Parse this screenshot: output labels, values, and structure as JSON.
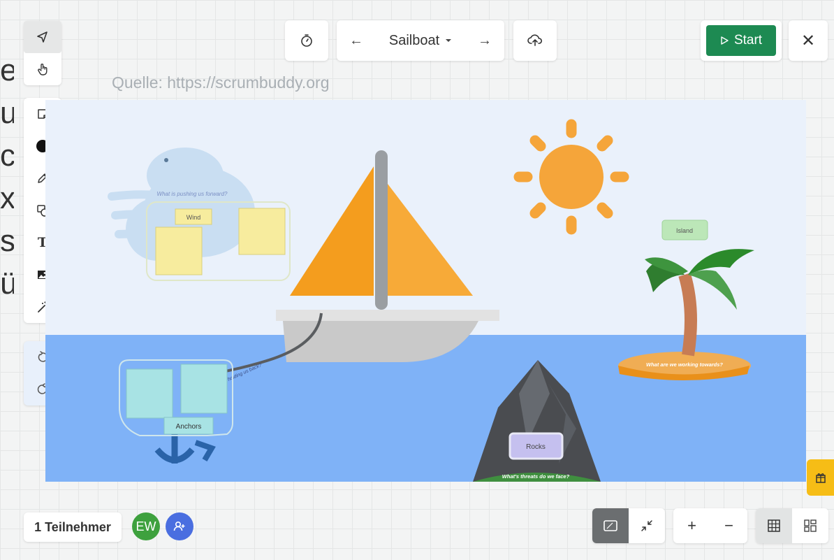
{
  "edge_letters": [
    "e",
    "u",
    "c",
    "x",
    "s",
    "ü"
  ],
  "toolbar": {
    "tools": [
      {
        "name": "select",
        "icon": "cursor-arrow-icon"
      },
      {
        "name": "hand",
        "icon": "hand-pointer-icon"
      },
      {
        "name": "sticky-note",
        "icon": "sticky-note-icon"
      },
      {
        "name": "color",
        "icon": "black-dot-icon"
      },
      {
        "name": "pen",
        "icon": "pencil-icon"
      },
      {
        "name": "shapes",
        "icon": "shapes-icon"
      },
      {
        "name": "text",
        "icon": "text-icon",
        "label": "T"
      },
      {
        "name": "image",
        "icon": "image-icon"
      },
      {
        "name": "magic",
        "icon": "magic-wand-icon"
      },
      {
        "name": "undo",
        "icon": "undo-icon"
      },
      {
        "name": "redo",
        "icon": "redo-icon"
      }
    ]
  },
  "topbar": {
    "board_title": "Sailboat",
    "prev_arrow": "←",
    "next_arrow": "→",
    "start_label": "Start",
    "close_label": "✕"
  },
  "source_text": "Quelle: https://scrumbuddy.org",
  "canvas": {
    "sticky_notes": [
      "Wind",
      "Anchors",
      "Island",
      "Rocks"
    ],
    "captions": {
      "wind": "What is pushing us forward?",
      "anchors": "holding us back?",
      "island": "What are we working towards?",
      "rocks": "What's threats do we face?"
    }
  },
  "footer": {
    "participants_label": "1 Teilnehmer",
    "avatar_initials": "EW",
    "zoom_in": "+",
    "zoom_out": "−"
  },
  "colors": {
    "start_green": "#1d8a52",
    "sky": "#eaf1fb",
    "sea": "#7fb2f7",
    "sail": "#f4a030",
    "sun": "#f5a53a",
    "side_tab": "#f6bd16"
  }
}
